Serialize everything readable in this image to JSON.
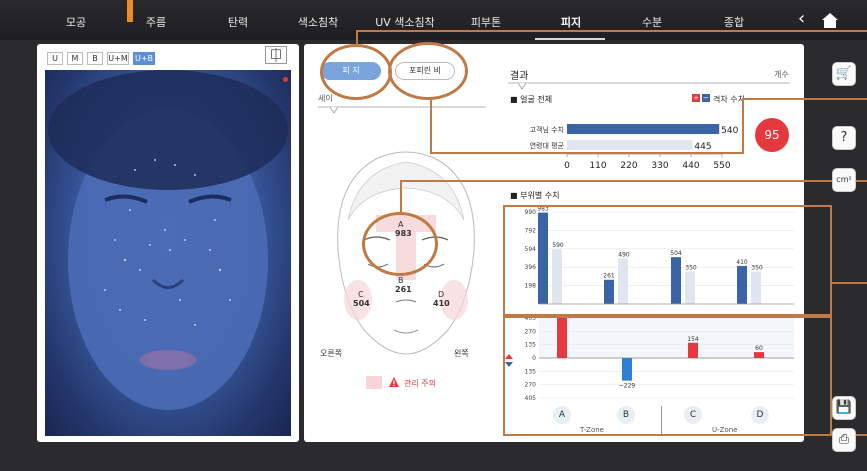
{
  "nav": {
    "tabs": [
      "모공",
      "주름",
      "탄력",
      "색소침착",
      "UV 색소침착",
      "피부톤",
      "피지",
      "수분",
      "종합"
    ],
    "active": "피지"
  },
  "photo_modes": [
    "U",
    "M",
    "B",
    "U+M",
    "U+B"
  ],
  "active_mode": "U+B",
  "sub_tabs": {
    "sebum": "피 지",
    "porphyrin": "포피린 비"
  },
  "area_label": "세이",
  "result": {
    "title": "결과",
    "unit": "개수",
    "whole_face": "■ 얼굴 전체",
    "legend_label": "격차 수치",
    "customer_label": "고객님 수치",
    "age_avg_label": "연령대 평균",
    "customer_value": "540",
    "age_avg_value": "445",
    "score": "95"
  },
  "region_section": "■ 부위별 수치",
  "face_map": {
    "left_side": "오른쪽",
    "right_side": "왼쪽",
    "caution": "관리 주의",
    "zones": [
      {
        "letter": "A",
        "value": "983"
      },
      {
        "letter": "B",
        "value": "261"
      },
      {
        "letter": "C",
        "value": "504"
      },
      {
        "letter": "D",
        "value": "410"
      }
    ]
  },
  "zone_groups": {
    "t_zone": "T-Zone",
    "u_zone": "U-Zone"
  },
  "colors": {
    "accent_blue": "#3a63a8",
    "accent_red": "#e53940",
    "orange": "#c07a45"
  },
  "chart_data": [
    {
      "type": "bar",
      "categories": [
        "고객님 수치",
        "연령대 평균"
      ],
      "values": [
        540,
        445
      ],
      "xlim": [
        0,
        550
      ],
      "xticks": [
        0,
        110,
        220,
        330,
        440,
        550
      ],
      "orientation": "horizontal"
    },
    {
      "type": "bar",
      "categories": [
        "A",
        "B",
        "C",
        "D"
      ],
      "series": [
        {
          "values": [
            983,
            261,
            504,
            410
          ]
        },
        {
          "values": [
            590,
            490,
            350,
            350
          ]
        }
      ],
      "ylim": [
        0,
        990
      ],
      "yticks": [
        0,
        198,
        396,
        594,
        792,
        990
      ]
    },
    {
      "type": "bar",
      "categories": [
        "A",
        "B",
        "C",
        "D"
      ],
      "values": [
        405,
        -229,
        154,
        60
      ],
      "labels": [
        "",
        "−229",
        "154",
        "60"
      ],
      "ylim": [
        -405,
        405
      ],
      "yticks": [
        405,
        270,
        135,
        0,
        135,
        270,
        405
      ]
    }
  ]
}
